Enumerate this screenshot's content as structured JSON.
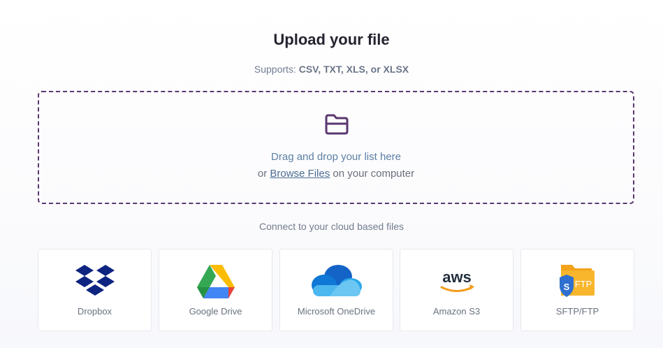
{
  "header": {
    "title": "Upload your file",
    "supports_prefix": "Supports: ",
    "supports_formats": "CSV, TXT, XLS, or XLSX"
  },
  "dropzone": {
    "icon": "folder-icon",
    "line1": "Drag and drop your list here",
    "line2_prefix": "or ",
    "browse_label": "Browse Files",
    "line2_suffix": " on your computer",
    "border_color": "#5a3770"
  },
  "cloud": {
    "heading": "Connect to your cloud based files",
    "providers": [
      {
        "label": "Dropbox",
        "icon": "dropbox-icon"
      },
      {
        "label": "Google Drive",
        "icon": "google-drive-icon"
      },
      {
        "label": "Microsoft OneDrive",
        "icon": "onedrive-icon"
      },
      {
        "label": "Amazon S3",
        "icon": "aws-icon",
        "logo_text": "aws"
      },
      {
        "label": "SFTP/FTP",
        "icon": "sftp-icon",
        "badge_letter": "S",
        "logo_text": "FTP"
      }
    ]
  },
  "colors": {
    "accent": "#5a3770",
    "link": "#4d6d92",
    "dropbox": "#0d2481",
    "onedrive": "#1a66c8",
    "aws_orange": "#f49c1b",
    "sftp_folder": "#f7a21b"
  }
}
